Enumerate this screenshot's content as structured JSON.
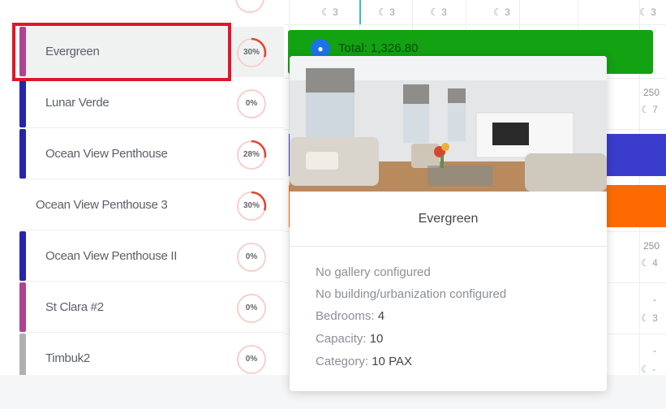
{
  "units": [
    {
      "name": "Evergreen",
      "percent": "30%",
      "progress": 0.3,
      "bar_color": "#b0438f",
      "selected": true
    },
    {
      "name": "Lunar Verde",
      "percent": "0%",
      "progress": 0,
      "bar_color": "#2525a8"
    },
    {
      "name": "Ocean View Penthouse",
      "percent": "28%",
      "progress": 0.28,
      "bar_color": "#2525a8"
    },
    {
      "name": "Ocean View Penthouse 3",
      "percent": "30%",
      "progress": 0.3,
      "bar_color": ""
    },
    {
      "name": "Ocean View Penthouse II",
      "percent": "0%",
      "progress": 0,
      "bar_color": "#2525a8"
    },
    {
      "name": "St Clara #2",
      "percent": "0%",
      "progress": 0,
      "bar_color": "#b0438f"
    },
    {
      "name": "Timbuk2",
      "percent": "0%",
      "progress": 0,
      "bar_color": "#b0b0b0"
    }
  ],
  "calendar": {
    "top_nights": [
      "3",
      "3",
      "3",
      "3",
      "3"
    ],
    "booking_total": "Total: 1,326.80",
    "right_col": [
      {
        "price": "250",
        "nights": "7"
      },
      {
        "price": "250",
        "nights": "4"
      },
      {
        "price": "-",
        "nights": "3"
      },
      {
        "price": "-",
        "nights": "-"
      }
    ],
    "colors": {
      "booking": "#12a212",
      "block_blue": "#3a3ccc",
      "block_orange": "#ff6a00"
    }
  },
  "popup": {
    "title": "Evergreen",
    "gallery": "No gallery configured",
    "building": "No building/urbanization configured",
    "bedrooms_label": "Bedrooms:",
    "bedrooms": "4",
    "capacity_label": "Capacity:",
    "capacity": "10",
    "category_label": "Category:",
    "category": "10 PAX"
  },
  "icons": {
    "night": "moon-icon",
    "booking": "person-icon"
  }
}
